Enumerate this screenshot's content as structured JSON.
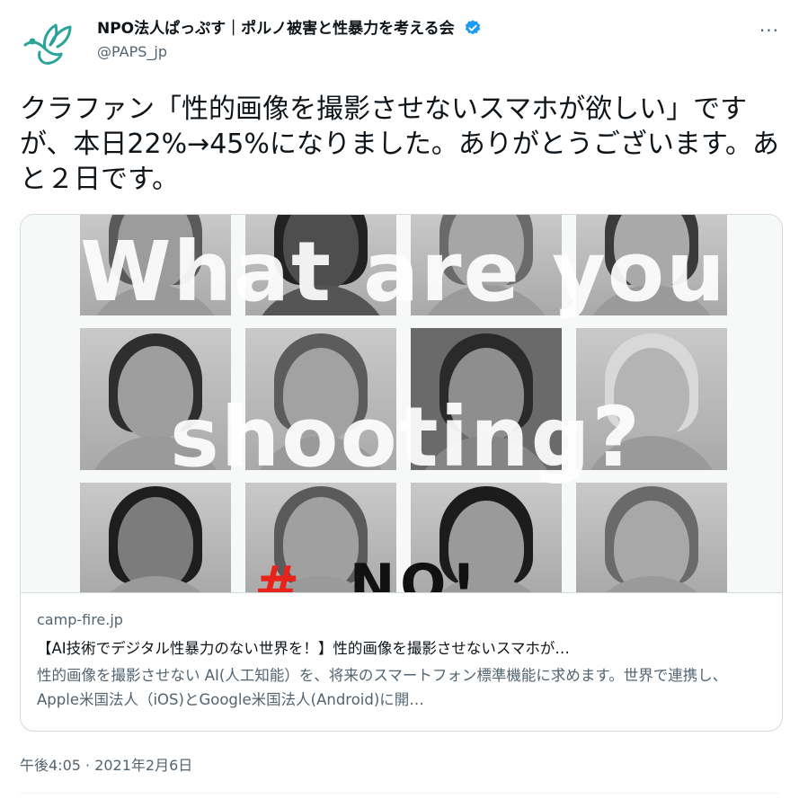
{
  "account": {
    "display_name": "NPO法人ぱっぷす｜ポルノ被害と性暴力を考える会",
    "handle": "@PAPS_jp",
    "avatar_icon": "bird-logo-icon",
    "verified_icon": "verified-badge-icon",
    "more_label": "···"
  },
  "tweet": {
    "text": "クラファン「性的画像を撮影させないスマホが欲しい」ですが、本日22%→45%になりました。ありがとうございます。あと２日です。",
    "timestamp": "午後4:05 · 2021年2月6日"
  },
  "card": {
    "image_text_line1": "What are you",
    "image_text_line2": "shooting?",
    "image_text_red": "#",
    "image_text_black": "NO!",
    "domain": "camp-fire.jp",
    "title": "【AI技術でデジタル性暴力のない世界を！】性的画像を撮影させないスマホが…",
    "description": "性的画像を撮影させない AI(人工知能）を、将来のスマートフォン標準機能に求めます。世界で連携し、Apple米国法人（iOS)とGoogle米国法人(Android)に開…"
  },
  "colors": {
    "text_primary": "#0f1419",
    "text_secondary": "#536471",
    "verified": "#1d9bf0",
    "logo": "#2aa39a",
    "border": "#cfd9de"
  }
}
